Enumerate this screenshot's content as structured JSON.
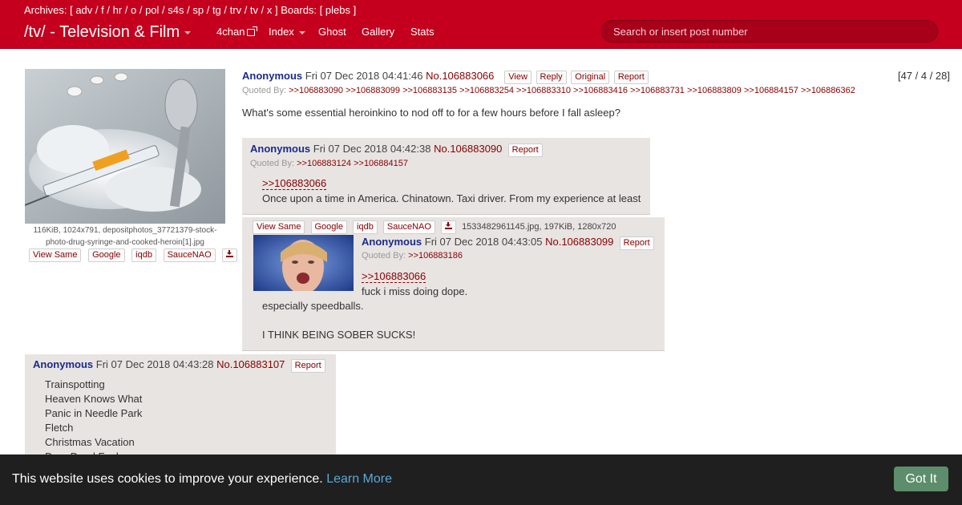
{
  "header": {
    "archives_prefix": "Archives: [",
    "archives": [
      "adv",
      "f",
      "hr",
      "o",
      "pol",
      "s4s",
      "sp",
      "tg",
      "trv",
      "tv",
      "x"
    ],
    "boards_prefix": "] Boards: [",
    "boards": [
      "plebs"
    ],
    "boards_suffix": "]",
    "brand": "/tv/ - Television & Film",
    "nav": [
      "4chan",
      "Index",
      "Ghost",
      "Gallery",
      "Stats"
    ],
    "search_placeholder": "Search or insert post number",
    "bg_color": "#c4001e"
  },
  "op": {
    "image_caption": "116KiB, 1024x791, depositphotos_37721379-stock-photo-drug-syringe-and-cooked-heroin[1].jpg",
    "image_buttons": [
      "View Same",
      "Google",
      "iqdb",
      "SauceNAO"
    ],
    "name": "Anonymous",
    "date": "Fri 07 Dec 2018 04:41:46",
    "number": "No.106883066",
    "buttons": [
      "View",
      "Reply",
      "Original",
      "Report"
    ],
    "stats": "[47 / 4 / 28]",
    "quoted_label": "Quoted By:",
    "quoted_by": [
      ">>106883090",
      ">>106883099",
      ">>106883135",
      ">>106883254",
      ">>106883310",
      ">>106883416",
      ">>106883731",
      ">>106883809",
      ">>106884157",
      ">>106886362"
    ],
    "text": "What's some essential heroinkino to nod off to for a few hours before I fall asleep?"
  },
  "replies": [
    {
      "name": "Anonymous",
      "date": "Fri 07 Dec 2018 04:42:38",
      "number": "No.106883090",
      "report": "Report",
      "quoted_label": "Quoted By:",
      "quoted_by": [
        ">>106883124",
        ">>106884157"
      ],
      "quote": ">>106883066",
      "lines": [
        "Once upon a time in America. Chinatown. Taxi driver. From my experience at least"
      ]
    },
    {
      "file_buttons": [
        "View Same",
        "Google",
        "iqdb",
        "SauceNAO"
      ],
      "file_info": "1533482961145.jpg, 197KiB, 1280x720",
      "name": "Anonymous",
      "date": "Fri 07 Dec 2018 04:43:05",
      "number": "No.106883099",
      "report": "Report",
      "quoted_label": "Quoted By:",
      "quoted_by": [
        ">>106883186"
      ],
      "quote": ">>106883066",
      "lines": [
        "fuck i miss doing dope.",
        "especially speedballs.",
        "",
        "I THINK BEING SOBER SUCKS!"
      ]
    },
    {
      "name": "Anonymous",
      "date": "Fri 07 Dec 2018 04:43:28",
      "number": "No.106883107",
      "report": "Report",
      "lines": [
        "Trainspotting",
        "Heaven Knows What",
        "Panic in Needle Park",
        "Fletch",
        "Christmas Vacation",
        "Drug Dead Fools"
      ]
    }
  ],
  "cookie": {
    "text": "This website uses cookies to improve your experience.",
    "link": "Learn More",
    "button": "Got It"
  }
}
